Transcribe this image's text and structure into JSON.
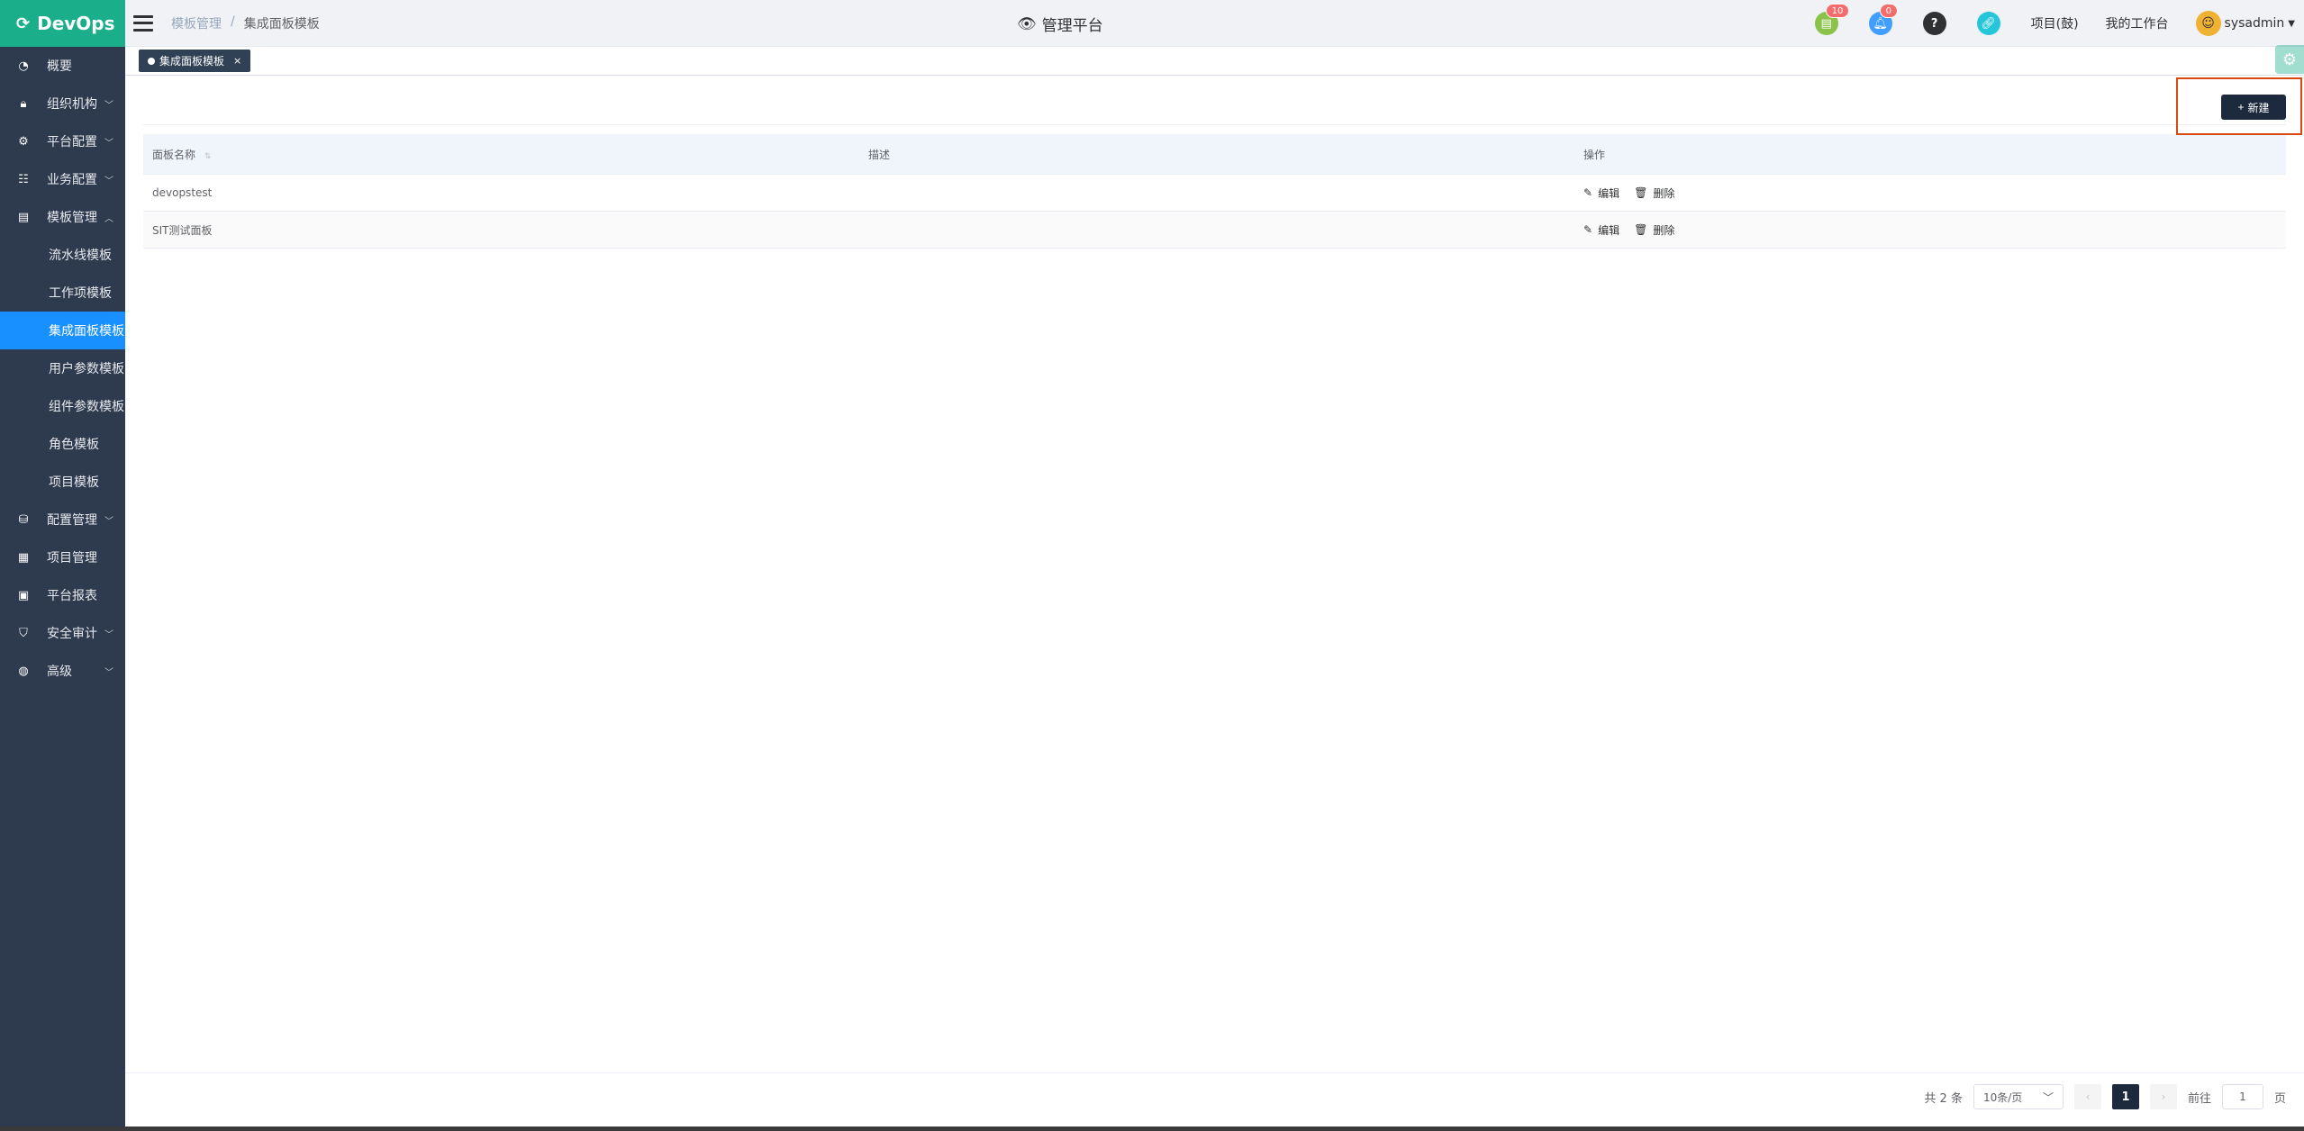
{
  "brand": {
    "logo_text": "DevOps"
  },
  "sidebar": {
    "items": [
      {
        "label": "概要",
        "icon": "dashboard-icon",
        "has_chevron": false
      },
      {
        "label": "组织机构",
        "icon": "lock-icon",
        "has_chevron": true
      },
      {
        "label": "平台配置",
        "icon": "gear-icon",
        "has_chevron": true
      },
      {
        "label": "业务配置",
        "icon": "sliders-icon",
        "has_chevron": true
      },
      {
        "label": "模板管理",
        "icon": "template-icon",
        "has_chevron": true,
        "expanded": true
      },
      {
        "label": "流水线模板",
        "sub": true
      },
      {
        "label": "工作项模板",
        "sub": true
      },
      {
        "label": "集成面板模板",
        "sub": true,
        "active": true
      },
      {
        "label": "用户参数模板",
        "sub": true
      },
      {
        "label": "组件参数模板",
        "sub": true
      },
      {
        "label": "角色模板",
        "sub": true
      },
      {
        "label": "项目模板",
        "sub": true
      },
      {
        "label": "配置管理",
        "icon": "database-icon",
        "has_chevron": true
      },
      {
        "label": "项目管理",
        "icon": "grid-icon",
        "has_chevron": false
      },
      {
        "label": "平台报表",
        "icon": "report-icon",
        "has_chevron": false
      },
      {
        "label": "安全审计",
        "icon": "shield-icon",
        "has_chevron": true
      },
      {
        "label": "高级",
        "icon": "palette-icon",
        "has_chevron": true
      }
    ]
  },
  "header": {
    "breadcrumb": [
      "模板管理",
      "集成面板模板"
    ],
    "breadcrumb_sep": "/",
    "title": "管理平台",
    "badges": {
      "todo": "10",
      "notice": "0"
    },
    "project_link": "项目(鼓)",
    "workbench_link": "我的工作台",
    "username": "sysadmin"
  },
  "tags": {
    "active_tag": "集成面板模板",
    "close": "×"
  },
  "toolbar": {
    "new_label": "新建"
  },
  "table": {
    "headers": [
      "面板名称",
      "描述",
      "操作"
    ],
    "rows": [
      {
        "name": "devopstest",
        "desc": ""
      },
      {
        "name": "SIT测试面板",
        "desc": ""
      }
    ],
    "edit_label": "编辑",
    "delete_label": "删除"
  },
  "pagination": {
    "total_text": "共 2 条",
    "page_size": "10条/页",
    "current_page": "1",
    "goto_label": "前往",
    "goto_value": "1",
    "page_suffix": "页"
  },
  "colors": {
    "sidebar_bg": "#2e3a4d",
    "brand_green": "#1aae8a",
    "active_blue": "#1890ff",
    "primary_dark": "#1d2a3d",
    "highlight_red": "#d9480f"
  }
}
